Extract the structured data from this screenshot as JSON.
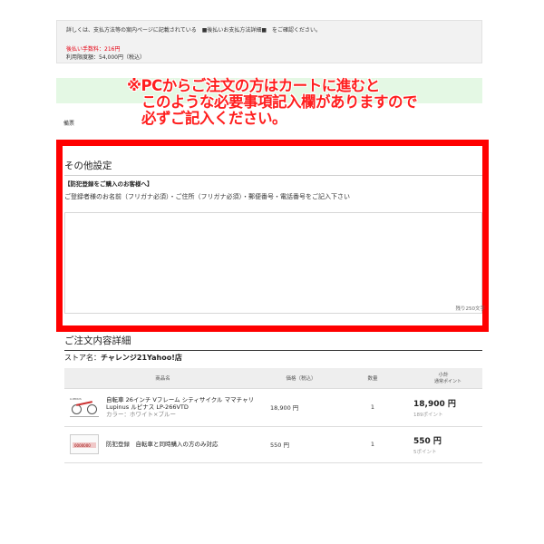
{
  "payment_info": {
    "note": "詳しくは、支払方法等の案内ページに記載されている　■後払いお支払方法詳細■　をご確認ください。",
    "fee": "後払い手数料：216円",
    "limit": "利用限度額：54,000円（税込）"
  },
  "callout": {
    "line1": "※PCからご注文の方はカートに進むと",
    "line2": "このような必要事項記入欄がありますので",
    "line3": "必ずご記入ください。"
  },
  "memo_label": "備票",
  "other_settings": {
    "title": "その他設定",
    "crime_heading": "【防犯登録をご購入のお客様へ】",
    "crime_description": "ご登録者様のお名前（フリガナ必須）・ご住所（フリガナ必須）・郵便番号・電話番号をご記入下さい",
    "textarea_value": "",
    "remaining": "残り250文字"
  },
  "order": {
    "title": "ご注文内容詳細",
    "store_label": "ストア名：",
    "store_name": "チャレンジ21Yahoo!店",
    "headers": {
      "product": "商品名",
      "price": "価格（税込）",
      "qty": "数量",
      "subtotal": "小計",
      "subtotal_sub": "通常ポイント"
    },
    "items": [
      {
        "name_line1": "自転車 26インチ Vフレーム シティサイクル ママチャリ",
        "name_line2": "Lupinus ルピナス LP-266VTD",
        "option": "カラー：ホワイト×ブルー",
        "price": "18,900 円",
        "qty": "1",
        "subtotal": "18,900 円",
        "points": "189ポイント",
        "icon": "bicycle-thumbnail"
      },
      {
        "name_line1": "防犯登録　自転車と同時購入の方のみ対応",
        "name_line2": "",
        "option": "",
        "price": "550 円",
        "qty": "1",
        "subtotal": "550 円",
        "points": "5ポイント",
        "icon": "registration-card-thumbnail"
      }
    ]
  },
  "colors": {
    "callout": "#ff1e1e",
    "frame": "#ff0000",
    "fee": "#e60012",
    "band": "#e4f8e4"
  }
}
